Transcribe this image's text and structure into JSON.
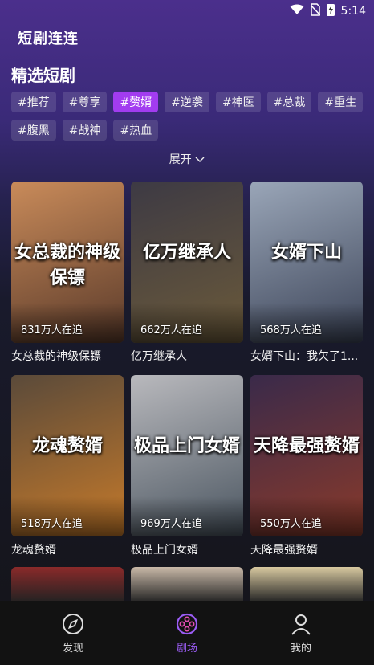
{
  "status": {
    "time": "5:14"
  },
  "app": {
    "title": "短剧连连"
  },
  "section": {
    "title": "精选短剧"
  },
  "tags": [
    {
      "label": "#推荐",
      "active": false
    },
    {
      "label": "#尊享",
      "active": false
    },
    {
      "label": "#赘婿",
      "active": true
    },
    {
      "label": "#逆袭",
      "active": false
    },
    {
      "label": "#神医",
      "active": false
    },
    {
      "label": "#总裁",
      "active": false
    },
    {
      "label": "#重生",
      "active": false
    },
    {
      "label": "#腹黑",
      "active": false
    },
    {
      "label": "#战神",
      "active": false
    },
    {
      "label": "#热血",
      "active": false
    }
  ],
  "expand": {
    "label": "展开"
  },
  "dramas": [
    {
      "title": "女总裁的神级保镖",
      "views": "831万人在追",
      "poster_text": "女总裁的神级保镖",
      "c1": "#c98b5a",
      "c2": "#5a3a2a"
    },
    {
      "title": "亿万继承人",
      "views": "662万人在追",
      "poster_text": "亿万继承人",
      "c1": "#3d3a44",
      "c2": "#6b5a3a"
    },
    {
      "title": "女婿下山：我欠了1...",
      "views": "568万人在追",
      "poster_text": "女婿下山",
      "c1": "#9aa6b8",
      "c2": "#3c4458"
    },
    {
      "title": "龙魂赘婿",
      "views": "518万人在追",
      "poster_text": "龙魂赘婿",
      "c1": "#5a4a3a",
      "c2": "#c67a2a"
    },
    {
      "title": "极品上门女婿",
      "views": "969万人在追",
      "poster_text": "极品上门女婿",
      "c1": "#b9b9bd",
      "c2": "#4a5560"
    },
    {
      "title": "天降最强赘婿",
      "views": "550万人在追",
      "poster_text": "天降最强赘婿",
      "c1": "#3a2a4a",
      "c2": "#8a3a2a"
    }
  ],
  "partial_colors": [
    "#8a2a2a",
    "#c9b9a8",
    "#d8c9a0"
  ],
  "nav": [
    {
      "label": "发现",
      "icon": "compass-icon",
      "active": false
    },
    {
      "label": "剧场",
      "icon": "film-reel-icon",
      "active": true
    },
    {
      "label": "我的",
      "icon": "user-icon",
      "active": false
    }
  ],
  "colors": {
    "accent": "#a23cf0"
  }
}
